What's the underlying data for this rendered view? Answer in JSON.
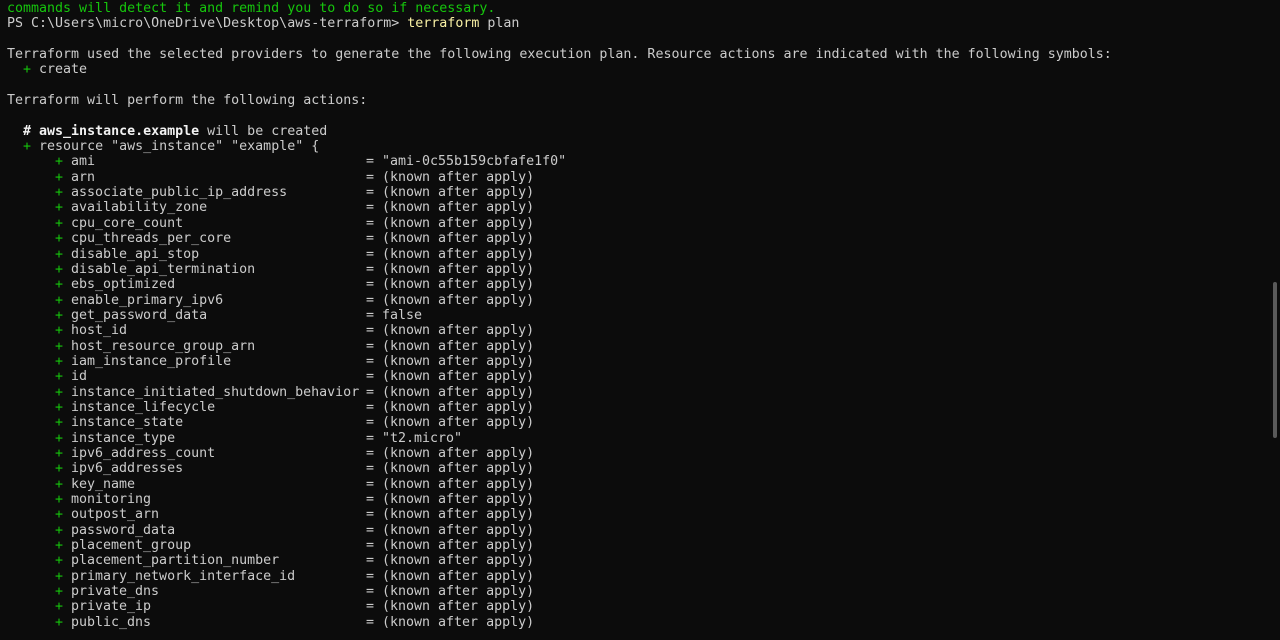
{
  "terminal": {
    "header_line": "commands will detect it and remind you to do so if necessary.",
    "prompt": "PS C:\\Users\\micro\\OneDrive\\Desktop\\aws-terraform>",
    "command": "terraform",
    "command_arg": "plan",
    "intro_line": "Terraform used the selected providers to generate the following execution plan. Resource actions are indicated with the following symbols:",
    "symbol_plus": "+",
    "symbol_label": "create",
    "actions_line": "Terraform will perform the following actions:",
    "resource_comment_hash": "#",
    "resource_comment_name": "aws_instance.example",
    "resource_comment_rest": "will be created",
    "resource_plus": "+",
    "resource_line": "resource \"aws_instance\" \"example\" {",
    "attributes": [
      {
        "name": "ami",
        "value": "\"ami-0c55b159cbfafe1f0\""
      },
      {
        "name": "arn",
        "value": "(known after apply)"
      },
      {
        "name": "associate_public_ip_address",
        "value": "(known after apply)"
      },
      {
        "name": "availability_zone",
        "value": "(known after apply)"
      },
      {
        "name": "cpu_core_count",
        "value": "(known after apply)"
      },
      {
        "name": "cpu_threads_per_core",
        "value": "(known after apply)"
      },
      {
        "name": "disable_api_stop",
        "value": "(known after apply)"
      },
      {
        "name": "disable_api_termination",
        "value": "(known after apply)"
      },
      {
        "name": "ebs_optimized",
        "value": "(known after apply)"
      },
      {
        "name": "enable_primary_ipv6",
        "value": "(known after apply)"
      },
      {
        "name": "get_password_data",
        "value": "false"
      },
      {
        "name": "host_id",
        "value": "(known after apply)"
      },
      {
        "name": "host_resource_group_arn",
        "value": "(known after apply)"
      },
      {
        "name": "iam_instance_profile",
        "value": "(known after apply)"
      },
      {
        "name": "id",
        "value": "(known after apply)"
      },
      {
        "name": "instance_initiated_shutdown_behavior",
        "value": "(known after apply)"
      },
      {
        "name": "instance_lifecycle",
        "value": "(known after apply)"
      },
      {
        "name": "instance_state",
        "value": "(known after apply)"
      },
      {
        "name": "instance_type",
        "value": "\"t2.micro\""
      },
      {
        "name": "ipv6_address_count",
        "value": "(known after apply)"
      },
      {
        "name": "ipv6_addresses",
        "value": "(known after apply)"
      },
      {
        "name": "key_name",
        "value": "(known after apply)"
      },
      {
        "name": "monitoring",
        "value": "(known after apply)"
      },
      {
        "name": "outpost_arn",
        "value": "(known after apply)"
      },
      {
        "name": "password_data",
        "value": "(known after apply)"
      },
      {
        "name": "placement_group",
        "value": "(known after apply)"
      },
      {
        "name": "placement_partition_number",
        "value": "(known after apply)"
      },
      {
        "name": "primary_network_interface_id",
        "value": "(known after apply)"
      },
      {
        "name": "private_dns",
        "value": "(known after apply)"
      },
      {
        "name": "private_ip",
        "value": "(known after apply)"
      },
      {
        "name": "public_dns",
        "value": "(known after apply)"
      }
    ],
    "attr_plus": "+",
    "attr_eq": "="
  },
  "colors": {
    "background": "#0c0c0c",
    "text": "#cccccc",
    "green": "#16c60c",
    "command": "#f9f1a5"
  }
}
